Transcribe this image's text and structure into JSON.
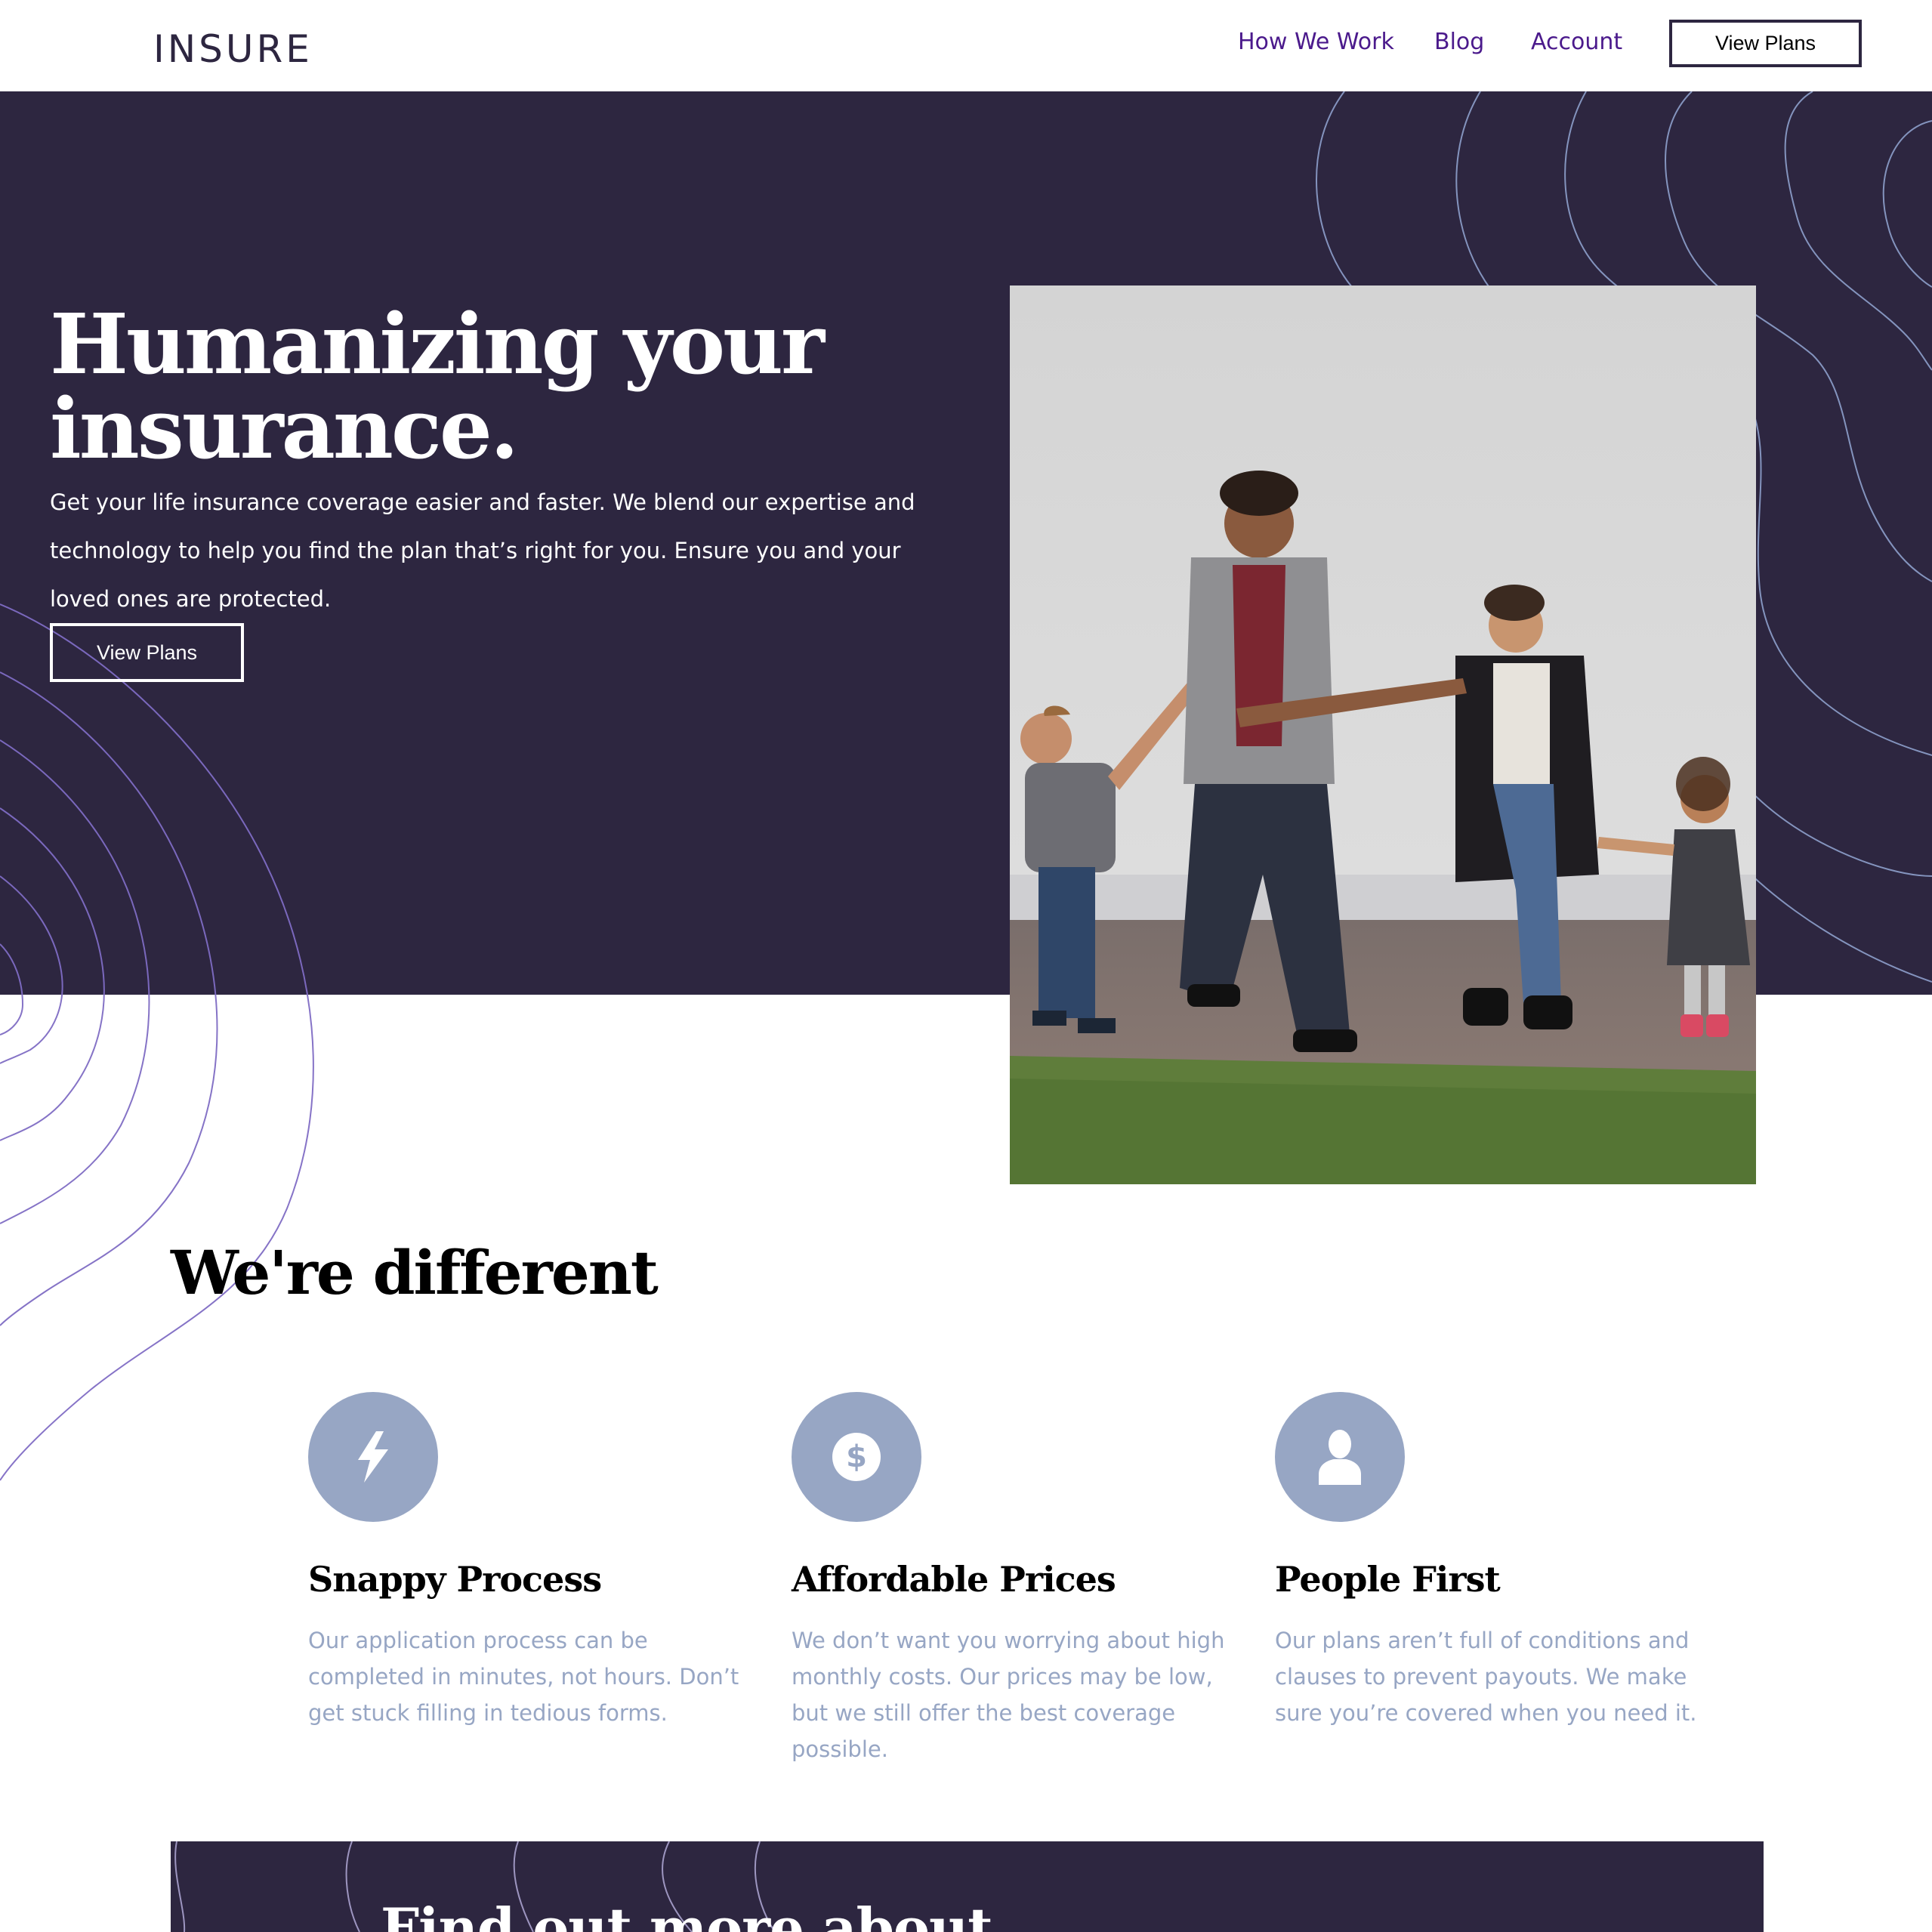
{
  "header": {
    "logo": "INSURE",
    "nav": [
      "How We Work",
      "Blog",
      "Account"
    ],
    "cta": "View Plans"
  },
  "hero": {
    "title": "Humanizing your insurance.",
    "text": "Get your life insurance coverage easier and faster. We blend our expertise and technology to help you find the plan that’s right for you. Ensure you and your loved ones are protected.",
    "button": "View Plans",
    "image": "family-walking-photo"
  },
  "different": {
    "title": "We're different",
    "features": [
      {
        "icon": "lightning-icon",
        "title": "Snappy Process",
        "text": "Our application process can be completed in minutes, not hours. Don’t get stuck filling in tedious forms."
      },
      {
        "icon": "dollar-icon",
        "title": "Affordable Prices",
        "text": "We don’t want you worrying about high monthly costs. Our prices may be low, but we still offer the best coverage possible."
      },
      {
        "icon": "person-icon",
        "title": "People First",
        "text": "Our plans aren’t full of conditions and clauses to prevent payouts. We make sure you’re covered when you need it."
      }
    ]
  },
  "cta": {
    "title": "Find out more about"
  },
  "colors": {
    "dark_violet": "#2d2640",
    "nav_link": "#4b1a8c",
    "icon_circle": "#97a6c4",
    "feature_text": "#97a6c4"
  }
}
